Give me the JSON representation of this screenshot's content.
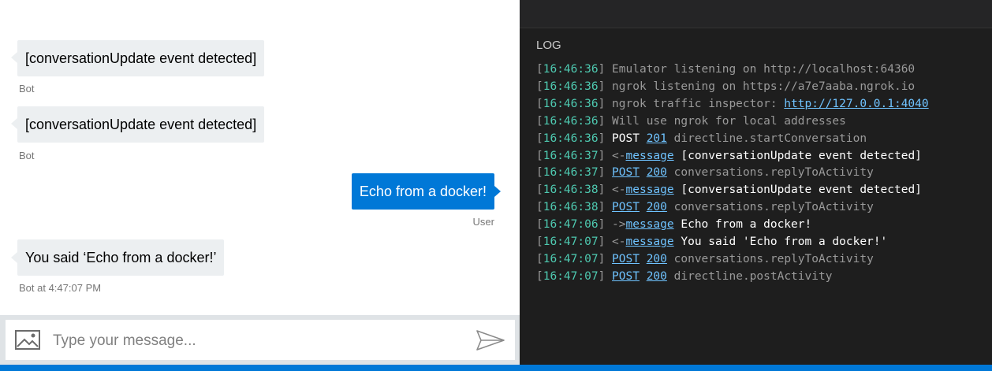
{
  "chat": {
    "messages": [
      {
        "text": "[conversationUpdate event detected]",
        "meta": "Bot"
      },
      {
        "text": "[conversationUpdate event detected]",
        "meta": "Bot"
      },
      {
        "text": "Echo from a docker!",
        "meta": "User"
      },
      {
        "text": "You said ‘Echo from a docker!’",
        "meta": "Bot at 4:47:07 PM"
      }
    ],
    "composer": {
      "placeholder": "Type your message..."
    }
  },
  "log": {
    "title": "LOG",
    "lines": [
      {
        "time": "16:46:36",
        "text": "Emulator listening on http://localhost:64360"
      },
      {
        "time": "16:46:36",
        "text": "ngrok listening on https://a7e7aaba.ngrok.io"
      },
      {
        "time": "16:46:36",
        "prefix": "ngrok traffic inspector: ",
        "link": "http://127.0.0.1:4040"
      },
      {
        "time": "16:46:36",
        "text": "Will use ngrok for local addresses"
      },
      {
        "time": "16:46:36",
        "method": "POST",
        "code": "201",
        "text": "directline.startConversation"
      },
      {
        "time": "16:46:37",
        "arrow": "<-",
        "link": "message",
        "text": "[conversationUpdate event detected]"
      },
      {
        "time": "16:46:37",
        "method": "POST",
        "code": "200",
        "text": "conversations.replyToActivity"
      },
      {
        "time": "16:46:38",
        "arrow": "<-",
        "link": "message",
        "text": "[conversationUpdate event detected]"
      },
      {
        "time": "16:46:38",
        "method": "POST",
        "code": "200",
        "text": "conversations.replyToActivity"
      },
      {
        "time": "16:47:06",
        "arrow": "->",
        "link": "message",
        "text": "Echo from a docker!"
      },
      {
        "time": "16:47:07",
        "arrow": "<-",
        "link": "message",
        "text": "You said 'Echo from a docker!'"
      },
      {
        "time": "16:47:07",
        "method": "POST",
        "code": "200",
        "text": "conversations.replyToActivity"
      },
      {
        "time": "16:47:07",
        "method": "POST",
        "code": "200",
        "text": "directline.postActivity"
      }
    ]
  }
}
